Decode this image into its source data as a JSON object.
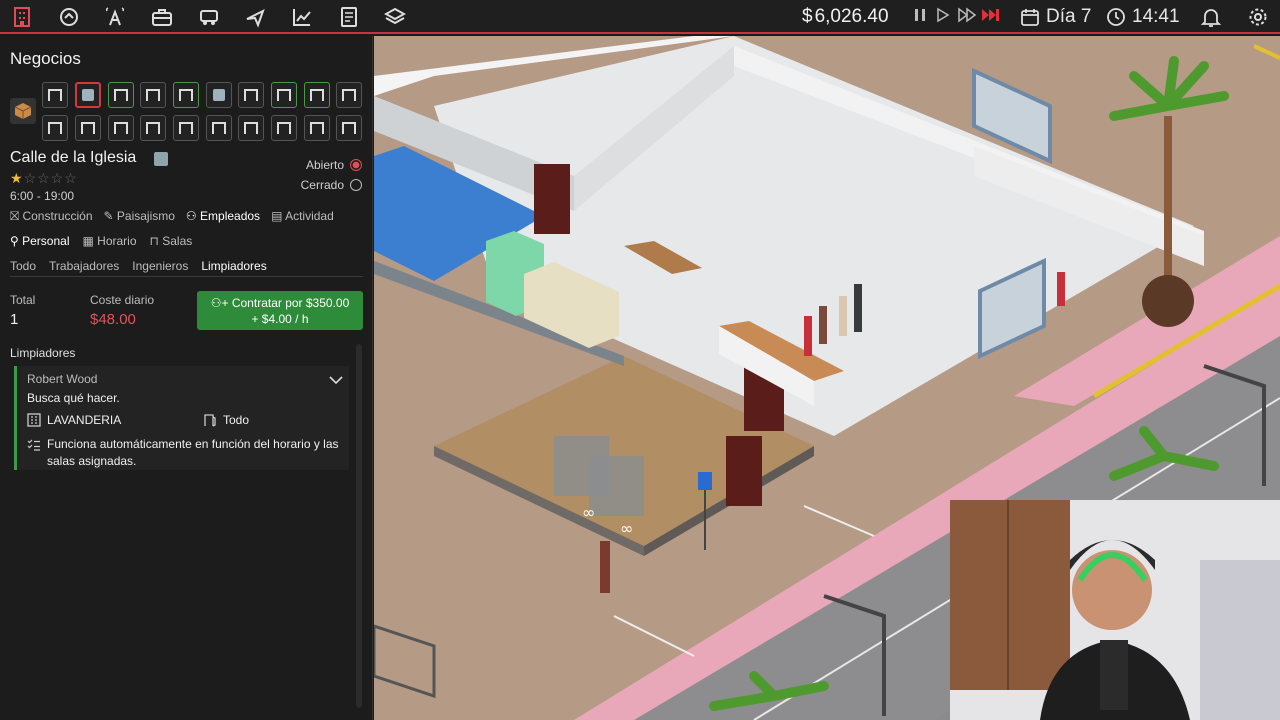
{
  "topbar": {
    "money": "6,026.40",
    "money_symbol": "$",
    "day": "Día 7",
    "time": "14:41",
    "icons": [
      "business-icon",
      "marketing-icon",
      "broadcast-icon",
      "jobs-icon",
      "logistics-icon",
      "travel-icon",
      "stats-icon",
      "ledger-icon",
      "layers-icon"
    ]
  },
  "panel": {
    "title": "Negocios",
    "street": "Calle de la Iglesia",
    "rating": "★☆☆☆☆",
    "hours": "6:00 - 19:00",
    "status_open": "Abierto",
    "status_closed": "Cerrado",
    "tabs_main": [
      "Construcción",
      "Paisajismo",
      "Empleados",
      "Actividad"
    ],
    "tabs_sub": [
      "Personal",
      "Horario",
      "Salas"
    ],
    "tabs_roles": [
      "Todo",
      "Trabajadores",
      "Ingenieros",
      "Limpiadores"
    ],
    "total_label": "Total",
    "total_value": "1",
    "cost_label": "Coste diario",
    "cost_value": "$48.00",
    "hire_line1": "Contratar por $350.00",
    "hire_line2": "+ $4.00 / h",
    "section": "Limpiadores",
    "employee": {
      "name": "Robert Wood",
      "message": "Busca qué hacer.",
      "room": "LAVANDERIA",
      "scope": "Todo",
      "note": "Funciona automáticamente en función del horario y las salas asignadas."
    }
  },
  "colors": {
    "accent_red": "#c9333c",
    "hire_green": "#2e8b3a",
    "cost_red": "#e2525a",
    "pause_red": "#e0303a"
  }
}
